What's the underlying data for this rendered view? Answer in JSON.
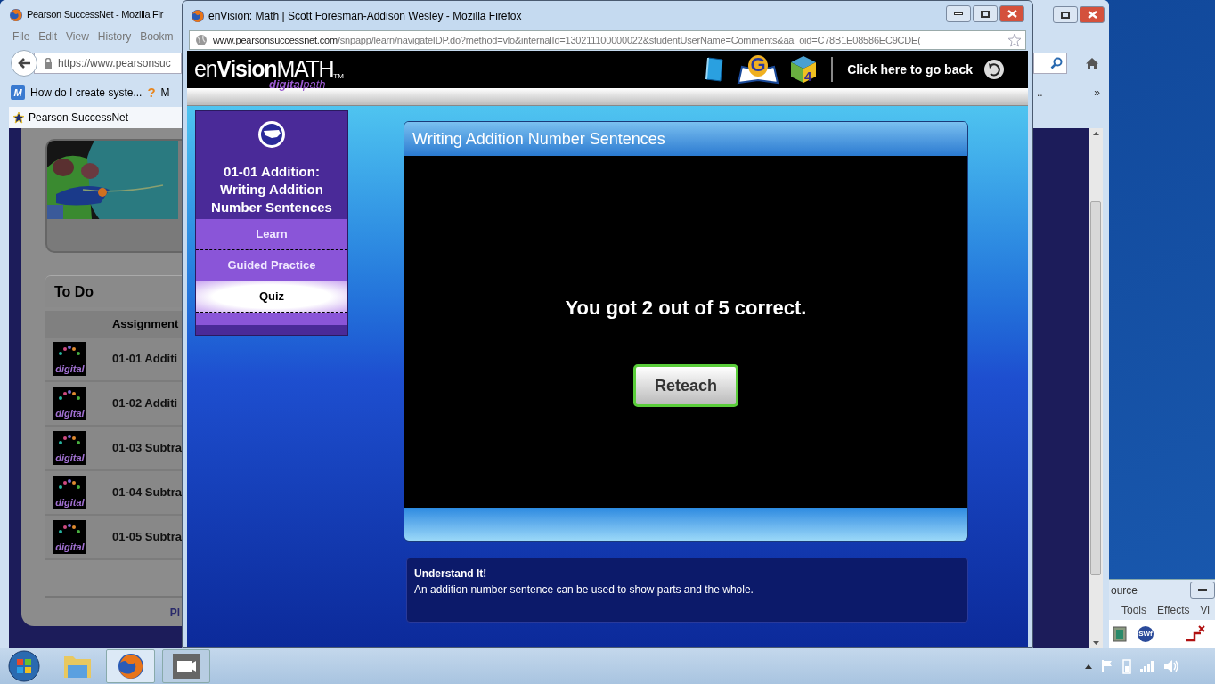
{
  "back_window": {
    "title": "Pearson SuccessNet - Mozilla Fir",
    "menu": [
      "File",
      "Edit",
      "View",
      "History",
      "Bookm"
    ],
    "url": "https://www.pearsonsuc",
    "bookmarks": [
      "How do I create syste...",
      "M"
    ],
    "bookmark_icon": "M",
    "help_icon": "?",
    "tab": "Pearson SuccessNet",
    "more_bookmarks": "..",
    "overflow": "»",
    "todo": {
      "title": "To Do",
      "column": "Assignment",
      "rows": [
        {
          "badge": "digital",
          "title": "01-01 Additi"
        },
        {
          "badge": "digital",
          "title": "01-02 Additi"
        },
        {
          "badge": "digital",
          "title": "01-03 Subtra"
        },
        {
          "badge": "digital",
          "title": "01-04 Subtra"
        },
        {
          "badge": "digital",
          "title": "01-05 Subtra"
        }
      ]
    },
    "footer": "Pl"
  },
  "front_window": {
    "title": "enVision: Math | Scott Foresman-Addison Wesley - Mozilla Firefox",
    "url_domain": "www.pearsonsuccessnet.com",
    "url_path": "/snpapp/learn/navigateIDP.do?method=vlo&internalId=130211100000022&studentUserName=Comments&aa_oid=C78B1E08586EC9CDE(",
    "logo": {
      "prefix": "en",
      "bold": "Vision",
      "suffix": "MATH",
      "tm": "TM",
      "tagline_bold": "digital",
      "tagline": "path"
    },
    "header_icons": [
      {
        "kind": "book"
      },
      {
        "kind": "letter",
        "label": "G"
      },
      {
        "kind": "cube",
        "label": "4"
      }
    ],
    "go_back": "Click here to go back",
    "lesson": {
      "title": "01-01 Addition: Writing Addition Number Sentences",
      "nav": [
        {
          "label": "Learn",
          "selected": false
        },
        {
          "label": "Guided Practice",
          "selected": false
        },
        {
          "label": "Quiz",
          "selected": true
        }
      ]
    },
    "panel": {
      "title": "Writing Addition Number Sentences",
      "result": "You got 2 out of 5 correct.",
      "button": "Reteach"
    },
    "info": {
      "heading": "Understand It!",
      "text": "An addition number sentence can be used to show parts and the whole."
    }
  },
  "third_window": {
    "title": "ource",
    "menu": [
      "Tools",
      "Effects",
      "Vi"
    ],
    "swf": "SWf"
  }
}
